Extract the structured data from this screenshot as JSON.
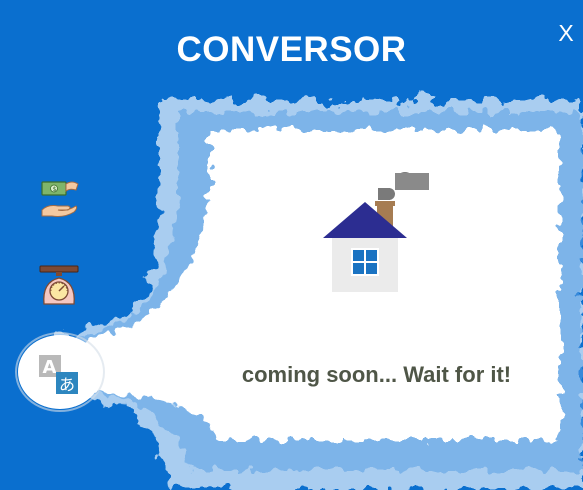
{
  "app": {
    "title": "CONVERSOR",
    "close_label": "X"
  },
  "colors": {
    "brand_blue": "#0a6fcf",
    "content_bg": "#ffffff",
    "status_text": "#4f5647"
  },
  "sidebar": {
    "items": [
      {
        "id": "currency",
        "icon": "money-exchange-icon",
        "selected": false
      },
      {
        "id": "weight",
        "icon": "weighing-scale-icon",
        "selected": false
      },
      {
        "id": "language",
        "icon": "translate-icon",
        "selected": true
      }
    ]
  },
  "main": {
    "illustration": "house-icon",
    "status": "coming soon... Wait for it!"
  }
}
